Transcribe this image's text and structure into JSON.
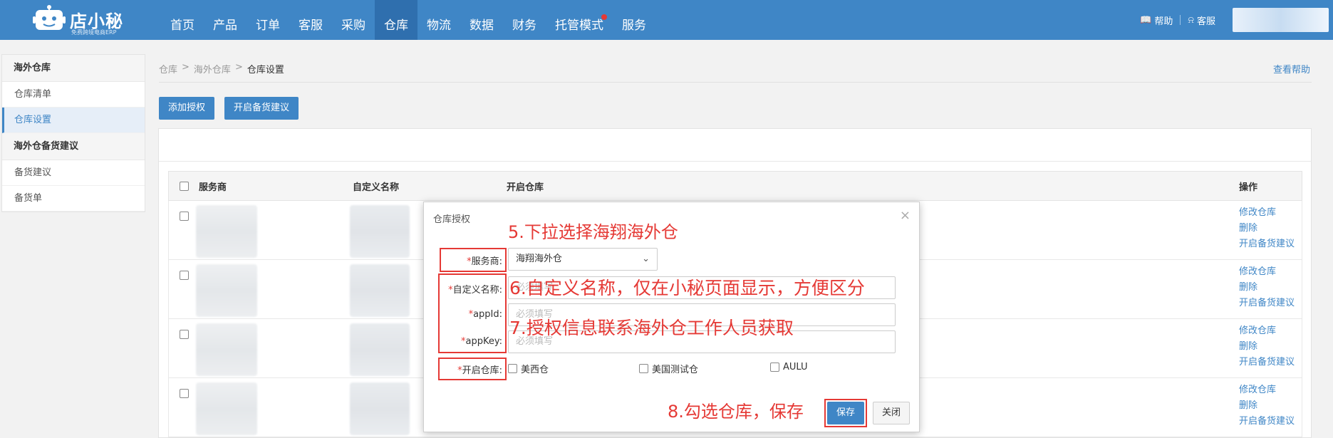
{
  "header": {
    "logo_title": "店小秘",
    "logo_subtitle": "免费跨境电商ERP",
    "nav": [
      "首页",
      "产品",
      "订单",
      "客服",
      "采购",
      "仓库",
      "物流",
      "数据",
      "财务",
      "托管模式",
      "服务"
    ],
    "active_nav": "仓库",
    "help_label": "帮助",
    "service_label": "客服"
  },
  "sidebar": {
    "group1": "海外仓库",
    "group1_items": [
      "仓库清单",
      "仓库设置"
    ],
    "group2": "海外仓备货建议",
    "group2_items": [
      "备货建议",
      "备货单"
    ]
  },
  "breadcrumb": [
    "仓库",
    "海外仓库",
    "仓库设置"
  ],
  "help_link": "查看帮助",
  "buttons": {
    "add_auth": "添加授权",
    "open_stock": "开启备货建议"
  },
  "table": {
    "headers": [
      "服务商",
      "自定义名称",
      "开启仓库",
      "操作"
    ],
    "ops": [
      "修改仓库",
      "删除",
      "开启备货建议"
    ]
  },
  "modal": {
    "title": "仓库授权",
    "provider_label": "服务商:",
    "provider_value": "海翔海外仓",
    "name_label": "自定义名称:",
    "appid_label": "appId:",
    "appkey_label": "appKey:",
    "placeholder": "必须填写",
    "warehouse_label": "开启仓库:",
    "warehouses": [
      "美西仓",
      "美国测试仓",
      "AULU"
    ],
    "save": "保存",
    "close": "关闭"
  },
  "annotations": {
    "a5": "5.下拉选择海翔海外仓",
    "a6": "6.自定义名称，仅在小秘页面显示，方便区分",
    "a7": "7.授权信息联系海外仓工作人员获取",
    "a8": "8.勾选仓库，保存"
  },
  "colors": {
    "brand": "#3f86c6",
    "annotation": "#e53935"
  }
}
